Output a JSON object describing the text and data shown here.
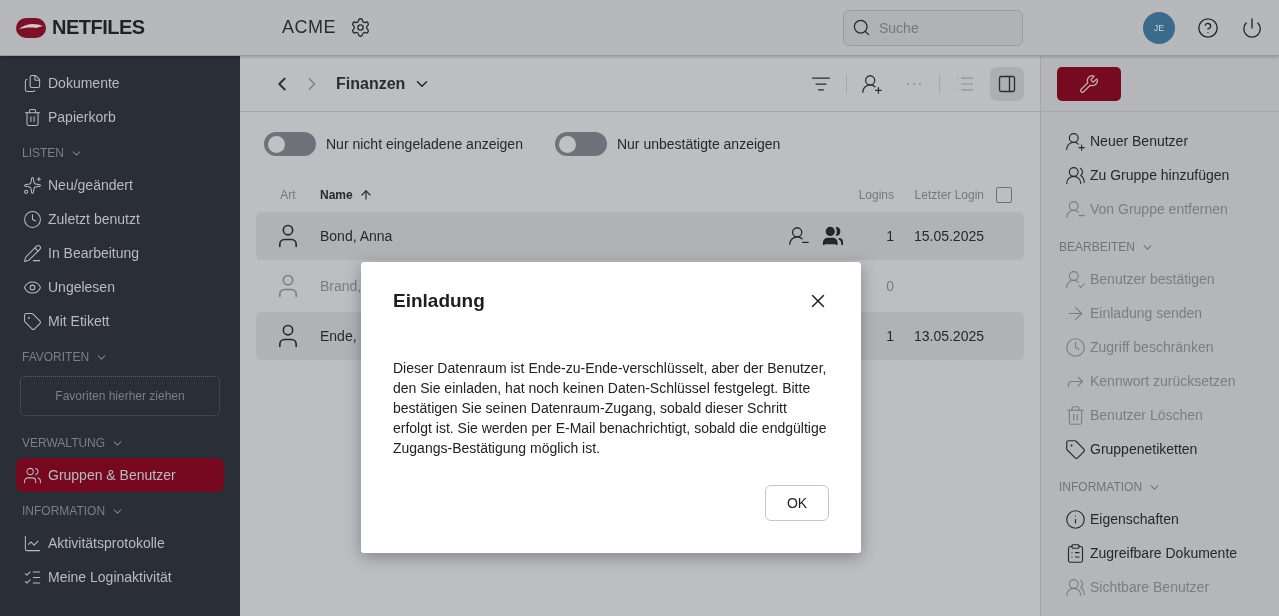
{
  "header": {
    "logo_text": "NETFILES",
    "workspace": "ACME",
    "search": {
      "placeholder": "Suche"
    },
    "avatar": "JE"
  },
  "sidebar": [
    {
      "kind": "items",
      "items": [
        {
          "label": "Dokumente",
          "selected": false
        },
        {
          "label": "Papierkorb",
          "selected": false
        }
      ]
    },
    {
      "kind": "items",
      "heading": "LISTEN",
      "items": [
        {
          "label": "Neu/geändert",
          "selected": false
        },
        {
          "label": "Zuletzt benutzt",
          "selected": false
        },
        {
          "label": "In Bearbeitung",
          "selected": false
        },
        {
          "label": "Ungelesen",
          "selected": false
        },
        {
          "label": "Mit Etikett",
          "selected": false
        }
      ]
    },
    {
      "kind": "dropzone",
      "heading": "FAVORITEN",
      "text": "Favoriten hierher ziehen"
    },
    {
      "kind": "items",
      "heading": "VERWALTUNG",
      "items": [
        {
          "label": "Gruppen & Benutzer",
          "selected": true
        }
      ]
    },
    {
      "kind": "items",
      "heading": "INFORMATION",
      "items": [
        {
          "label": "Aktivitätsprotokolle",
          "selected": false
        },
        {
          "label": "Meine Loginaktivität",
          "selected": false
        }
      ]
    }
  ],
  "breadcrumb": {
    "folder": "Finanzen"
  },
  "filters": [
    {
      "label": "Nur nicht eingeladene anzeigen",
      "on": false
    },
    {
      "label": "Nur unbestätigte anzeigen",
      "on": false
    }
  ],
  "table": {
    "columns": [
      "Art",
      "Name",
      "Logins",
      "Letzter Login"
    ],
    "select_all_checked": false,
    "rows": [
      {
        "name": "Bond, Anna",
        "logins": "1",
        "last_login": "15.05.2025",
        "selected": true,
        "pending": false,
        "has_groups": true
      },
      {
        "name": "Brand,",
        "logins": "0",
        "selected": false,
        "pending": true
      },
      {
        "name": "Ende,",
        "logins": "1",
        "last_login": "13.05.2025",
        "selected": true,
        "pending": false
      }
    ]
  },
  "actions": [
    {
      "items": [
        {
          "label": "Neuer Benutzer",
          "disabled": false
        },
        {
          "label": "Zu Gruppe hinzufügen",
          "disabled": false
        },
        {
          "label": "Von Gruppe entfernen",
          "disabled": true
        }
      ]
    },
    {
      "heading": "BEARBEITEN",
      "items": [
        {
          "label": "Benutzer bestätigen",
          "disabled": true
        },
        {
          "label": "Einladung senden",
          "disabled": true
        },
        {
          "label": "Zugriff beschränken",
          "disabled": true
        },
        {
          "label": "Kennwort zurücksetzen",
          "disabled": true
        },
        {
          "label": "Benutzer Löschen",
          "disabled": true
        },
        {
          "label": "Gruppenetiketten",
          "disabled": false
        }
      ]
    },
    {
      "heading": "INFORMATION",
      "items": [
        {
          "label": "Eigenschaften",
          "disabled": false
        },
        {
          "label": "Zugreifbare Dokumente",
          "disabled": false
        },
        {
          "label": "Sichtbare Benutzer",
          "disabled": true
        }
      ]
    }
  ],
  "dialog": {
    "title": "Einladung",
    "message": "Dieser Datenraum ist Ende-zu-Ende-verschlüsselt, aber der Benutzer, den Sie einladen, hat noch keinen Daten-Schlüssel festgelegt. Bitte bestätigen Sie seinen Datenraum-Zugang, sobald dieser Schritt erfolgt ist. Sie werden per E-Mail benachrichtigt, sobald die endgültige Zugangs-Bestätigung möglich ist.",
    "button": "OK"
  }
}
